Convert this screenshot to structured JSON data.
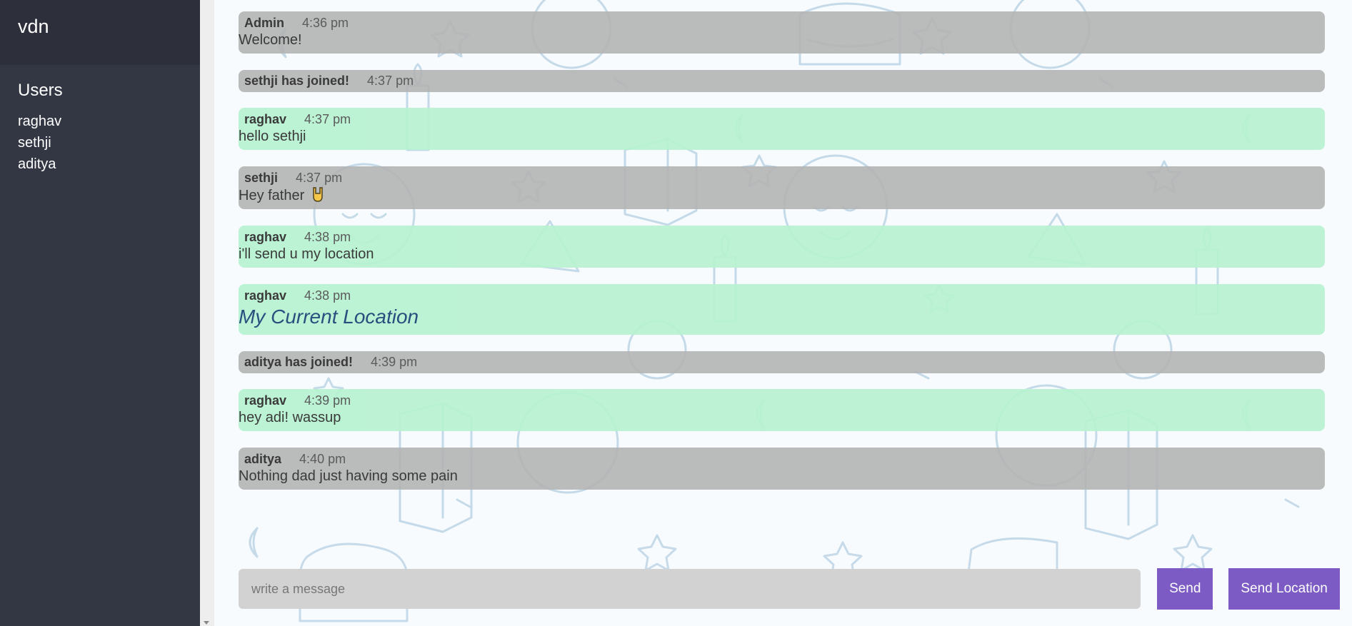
{
  "room": {
    "title": "vdn"
  },
  "sidebar": {
    "users_heading": "Users",
    "users": [
      "raghav",
      "sethji",
      "aditya"
    ]
  },
  "messages": [
    {
      "name": "Admin",
      "time": "4:36 pm",
      "text": "Welcome!",
      "kind": "other"
    },
    {
      "name": "sethji has joined!",
      "time": "4:37 pm",
      "text": "",
      "kind": "system"
    },
    {
      "name": "raghav",
      "time": "4:37 pm",
      "text": "hello sethji",
      "kind": "self"
    },
    {
      "name": "sethji",
      "time": "4:37 pm",
      "text": "Hey father",
      "kind": "other",
      "emoji": "rock-on-hand-icon"
    },
    {
      "name": "raghav",
      "time": "4:38 pm",
      "text": "i'll send u my location",
      "kind": "self"
    },
    {
      "name": "raghav",
      "time": "4:38 pm",
      "text": "My Current Location",
      "kind": "self",
      "link": true
    },
    {
      "name": "aditya has joined!",
      "time": "4:39 pm",
      "text": "",
      "kind": "system"
    },
    {
      "name": "raghav",
      "time": "4:39 pm",
      "text": "hey adi! wassup",
      "kind": "self"
    },
    {
      "name": "aditya",
      "time": "4:40 pm",
      "text": "Nothing dad just having some pain",
      "kind": "other"
    }
  ],
  "composer": {
    "placeholder": "write a message",
    "value": "",
    "send_label": "Send",
    "send_location_label": "Send Location"
  },
  "colors": {
    "sidebar_bg": "#333744",
    "sidebar_header_bg": "#2d2f3a",
    "self_bubble": "#b6f2d0",
    "other_bubble": "#b2b2b2",
    "button": "#7c5cc4",
    "input_bg": "#d2d2d2",
    "doodle_stroke": "#b5cfe3"
  }
}
